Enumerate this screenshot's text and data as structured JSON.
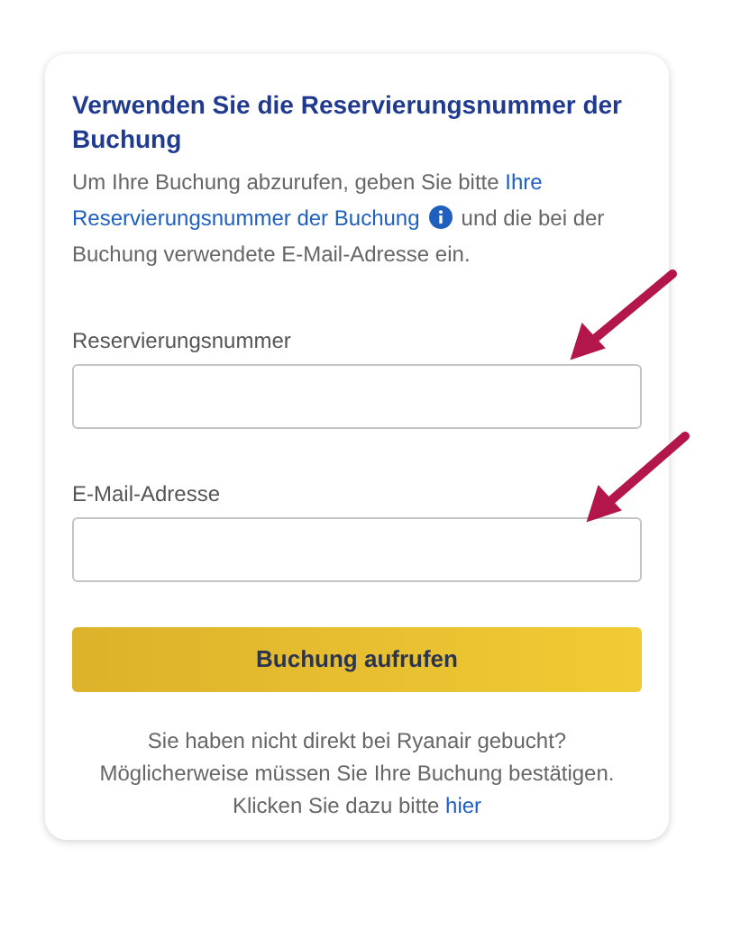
{
  "title": "Verwenden Sie die Reservierungsnummer der Buchung",
  "intro": {
    "before": "Um Ihre Buchung abzurufen, geben Sie bitte",
    "link_parts": [
      "Ihre",
      "Reservierungsnummer der Buchung"
    ],
    "after": "und die bei der Buchung verwendete E-Mail-Adresse ein."
  },
  "fields": [
    {
      "label": "Reservierungsnummer"
    },
    {
      "label": "E-Mail-Adresse"
    }
  ],
  "submit_button": "Buchung aufrufen",
  "footer": {
    "lines": [
      "Sie haben nicht direkt bei Ryanair gebucht?",
      "Möglicherweise müssen Sie Ihre Buchung bestätigen.",
      "Klicken Sie dazu bitte"
    ],
    "link": "hier"
  }
}
